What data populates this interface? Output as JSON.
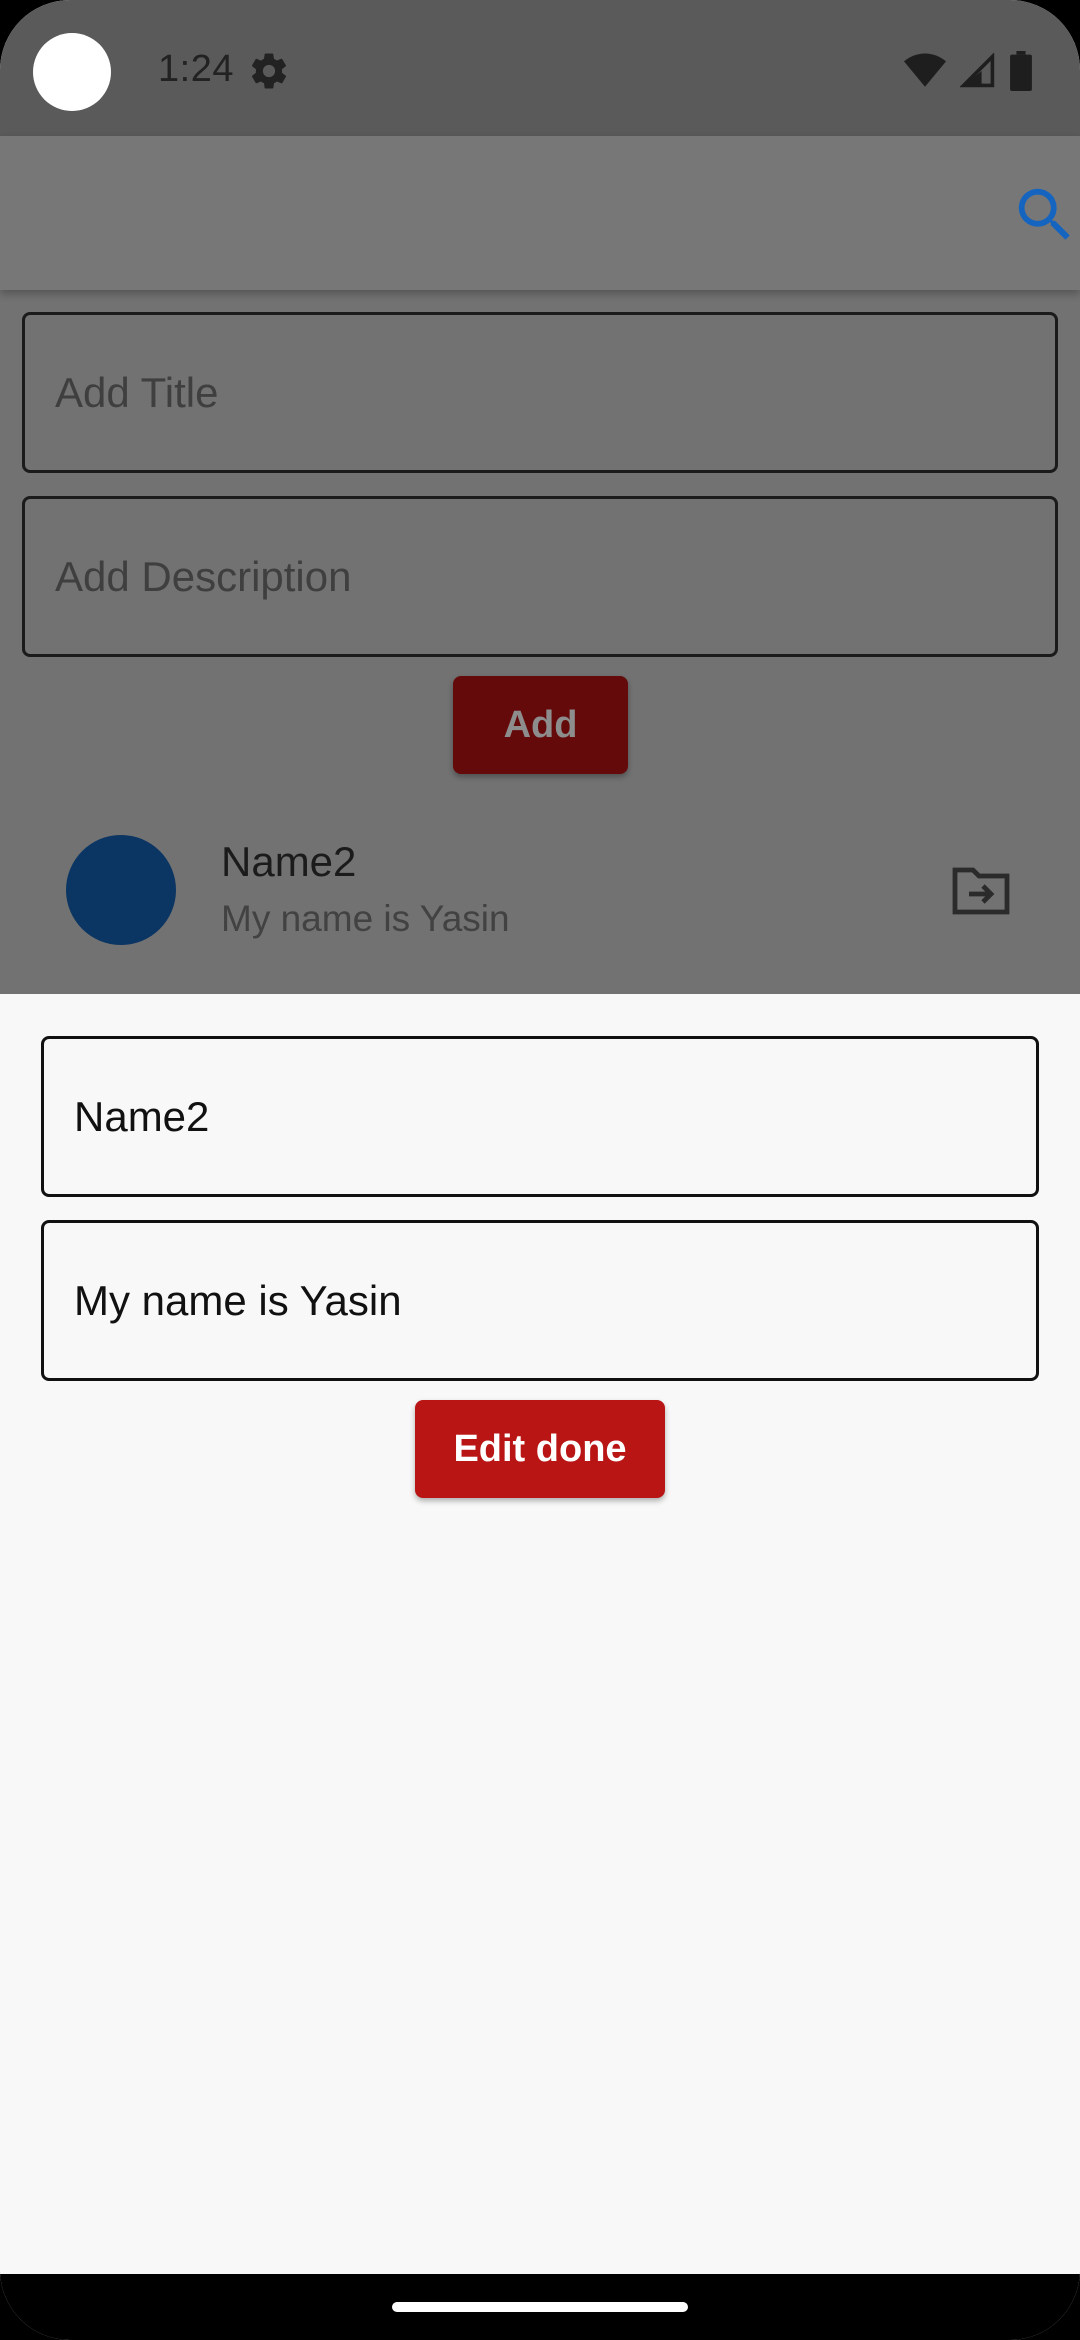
{
  "status_bar": {
    "time": "1:24",
    "icons": [
      "settings-gear-icon",
      "wifi-icon",
      "cell-signal-icon",
      "battery-icon"
    ]
  },
  "app_bar": {
    "search_icon": "search-icon",
    "accent": "#1565c0"
  },
  "form": {
    "title_placeholder": "Add Title",
    "description_placeholder": "Add Description",
    "add_label": "Add"
  },
  "list": {
    "items": [
      {
        "title": "Name2",
        "subtitle": "My name is Yasin",
        "avatar_color": "#0b3562",
        "action_icon": "folder-move-icon"
      }
    ]
  },
  "edit_sheet": {
    "title_value": "Name2",
    "description_value": "My name is Yasin",
    "done_label": "Edit done",
    "button_color": "#b91515"
  }
}
